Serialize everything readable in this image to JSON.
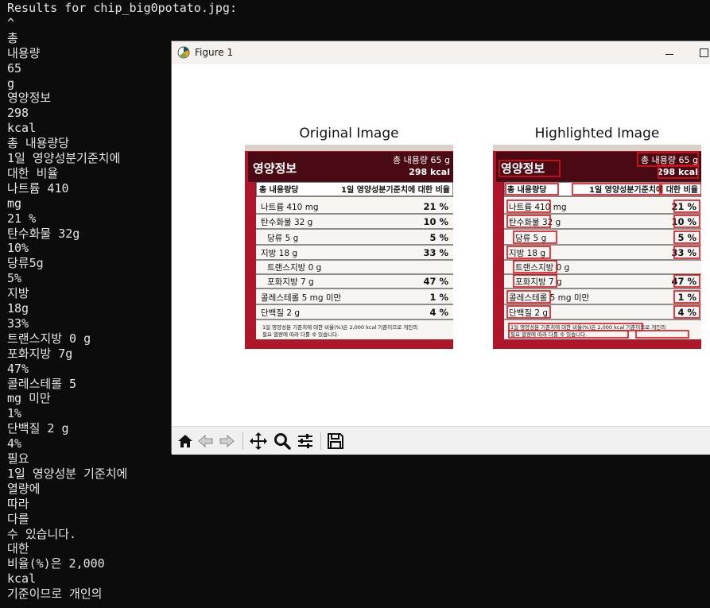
{
  "terminal": {
    "lines": [
      "Results for chip_big0potato.jpg:",
      "^",
      "총",
      "내용량",
      "65",
      "g",
      "영양정보",
      "298",
      "kcal",
      "총 내용량당",
      "1일 영양성분기준치에",
      "대한 비율",
      "나트륨 410",
      "mg",
      "21 %",
      "탄수화물 32g",
      "10%",
      "당류5g",
      "5%",
      "지방",
      "18g",
      "33%",
      "트랜스지방 0 g",
      "포화지방 7g",
      "47%",
      "콜레스테롤 5",
      "mg 미만",
      "1%",
      "단백질 2 g",
      "4%",
      "필요",
      "1일 영양성분 기준치에",
      "열량에",
      "따라",
      "다를",
      "수 있습니다.",
      "대한",
      "비율(%)은 2,000",
      "kcal",
      "기준이므로 개인의"
    ]
  },
  "figure": {
    "window_title": "Figure 1",
    "subplot_titles": [
      "Original Image",
      "Highlighted Image"
    ],
    "label": {
      "header": "영양정보",
      "total": "총 내용량 65 g",
      "kcal": "298 kcal",
      "col_left": "총 내용량당",
      "col_right": "1일 영양성분기준치에 대한 비율",
      "rows": [
        {
          "name": "나트륨 410 mg",
          "pct": "21 %"
        },
        {
          "name": "탄수화물 32 g",
          "pct": "10 %"
        },
        {
          "name": "당류 5 g",
          "pct": "5 %"
        },
        {
          "name": "지방 18 g",
          "pct": "33 %"
        },
        {
          "name": "트랜스지방 0 g",
          "pct": ""
        },
        {
          "name": "포화지방 7 g",
          "pct": "47 %"
        },
        {
          "name": "콜레스테롤 5 mg 미만",
          "pct": "1 %"
        },
        {
          "name": "단백질 2 g",
          "pct": "4 %"
        }
      ],
      "footnote1": "1일 영양성분 기준치에 대한 비율(%)은 2,000 kcal 기준이므로 개인의",
      "footnote2": "필요 열량에 따라 다를 수 있습니다."
    },
    "colors": {
      "label_red": "#b0162a",
      "label_dark": "#4a0a14",
      "highlight_box": "#e0101a"
    },
    "toolbar_icons": [
      "home-icon",
      "back-icon",
      "forward-icon",
      "pan-icon",
      "zoom-icon",
      "configure-subplots-icon",
      "save-icon"
    ]
  }
}
